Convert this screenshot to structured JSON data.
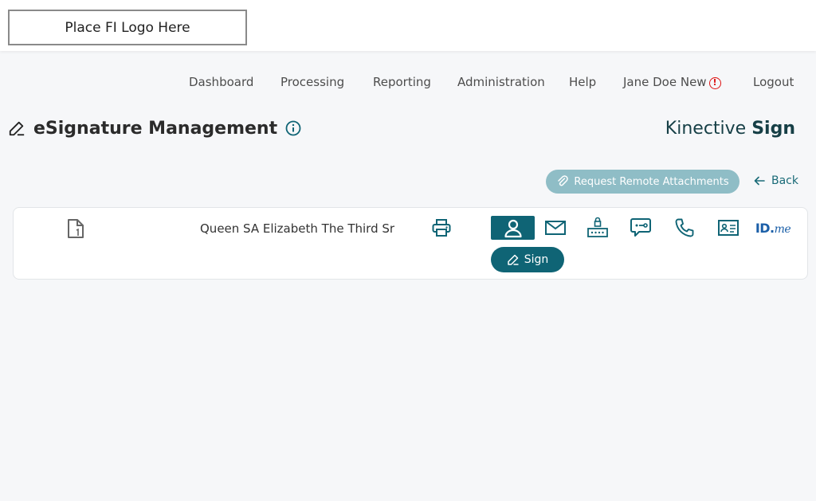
{
  "header": {
    "logo_text": "Place FI Logo Here"
  },
  "nav": {
    "items": [
      "Dashboard",
      "Processing",
      "Reporting",
      "Administration",
      "Help",
      "Jane Doe New",
      "Logout"
    ],
    "alert_symbol": "!"
  },
  "page": {
    "title": "eSignature Management",
    "brand_light": "Kinective",
    "brand_bold": "Sign"
  },
  "actions": {
    "remote_attachments_label": "Request Remote Attachments",
    "back_label": "Back"
  },
  "signer": {
    "name": "Queen SA Elizabeth The Third Sr",
    "auth_methods": [
      "person-icon",
      "email-icon",
      "kba-lock-icon",
      "sms-code-icon",
      "phone-icon",
      "id-card-icon",
      "idme-logo"
    ],
    "active_method": "person-icon",
    "idme_bold": "ID.",
    "idme_italic": "me",
    "sign_label": "Sign"
  },
  "colors": {
    "primary": "#0f6475",
    "primary_light": "#8fbdc6",
    "alert": "#dd1111",
    "brand": "#163f46",
    "idme": "#1b5fa8"
  }
}
